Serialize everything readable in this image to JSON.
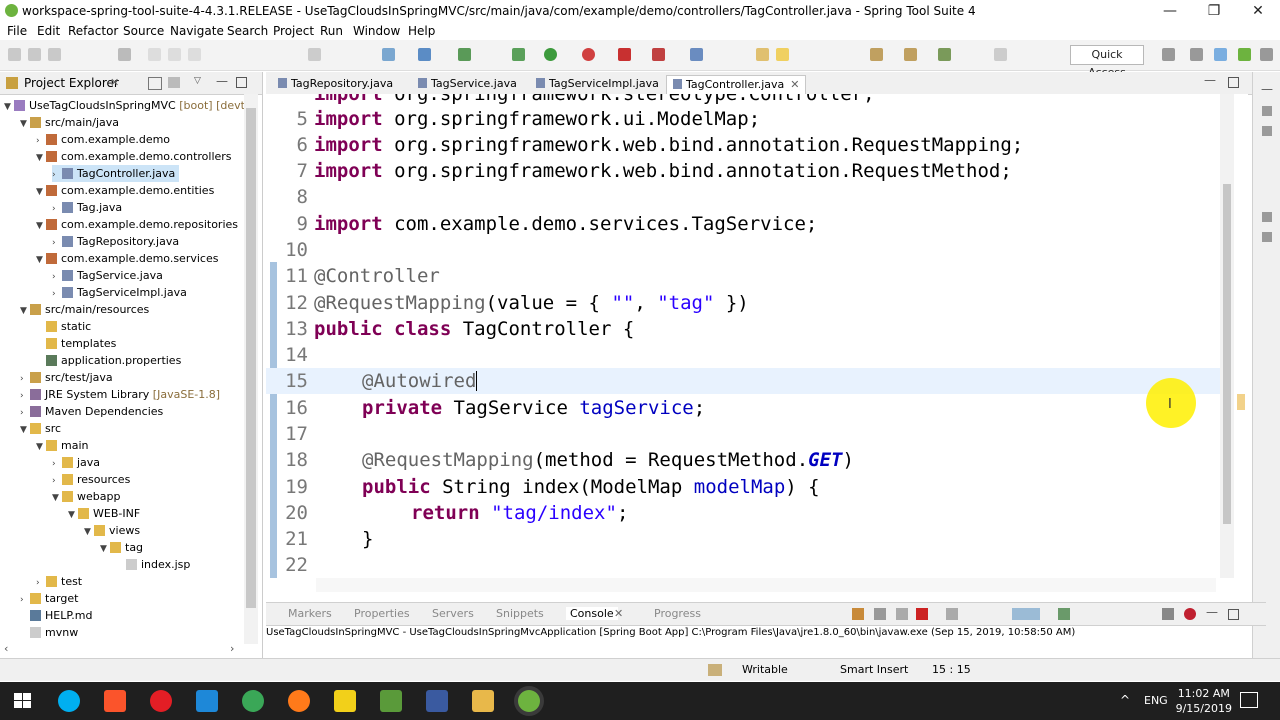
{
  "window": {
    "title": "workspace-spring-tool-suite-4-4.3.1.RELEASE - UseTagCloudsInSpringMVC/src/main/java/com/example/demo/controllers/TagController.java - Spring Tool Suite 4",
    "minimize": "—",
    "maximize": "❐",
    "close": "✕"
  },
  "menu": [
    "File",
    "Edit",
    "Refactor",
    "Source",
    "Navigate",
    "Search",
    "Project",
    "Run",
    "Window",
    "Help"
  ],
  "toolbar": {
    "quick_access": "Quick Access"
  },
  "project_explorer": {
    "title": "Project Explorer",
    "items": [
      {
        "label": "UseTagCloudsInSpringMVC",
        "suffix": " [boot] [devtools]"
      },
      {
        "label": "src/main/java"
      },
      {
        "label": "com.example.demo"
      },
      {
        "label": "com.example.demo.controllers"
      },
      {
        "label": "TagController.java"
      },
      {
        "label": "com.example.demo.entities"
      },
      {
        "label": "Tag.java"
      },
      {
        "label": "com.example.demo.repositories"
      },
      {
        "label": "TagRepository.java"
      },
      {
        "label": "com.example.demo.services"
      },
      {
        "label": "TagService.java"
      },
      {
        "label": "TagServiceImpl.java"
      },
      {
        "label": "src/main/resources"
      },
      {
        "label": "static"
      },
      {
        "label": "templates"
      },
      {
        "label": "application.properties"
      },
      {
        "label": "src/test/java"
      },
      {
        "label": "JRE System Library",
        "suffix": " [JavaSE-1.8]"
      },
      {
        "label": "Maven Dependencies"
      },
      {
        "label": "src"
      },
      {
        "label": "main"
      },
      {
        "label": "java"
      },
      {
        "label": "resources"
      },
      {
        "label": "webapp"
      },
      {
        "label": "WEB-INF"
      },
      {
        "label": "views"
      },
      {
        "label": "tag"
      },
      {
        "label": "index.jsp"
      },
      {
        "label": "test"
      },
      {
        "label": "target"
      },
      {
        "label": "HELP.md"
      },
      {
        "label": "mvnw"
      }
    ]
  },
  "editor": {
    "tabs": [
      "TagRepository.java",
      "TagService.java",
      "TagServiceImpl.java",
      "TagController.java"
    ],
    "active_tab": "TagController.java",
    "lines": [
      {
        "n": "",
        "kw": "import",
        "rest": " org.springframework.stereotype.Controller;"
      },
      {
        "n": "5",
        "kw": "import",
        "rest": " org.springframework.ui.ModelMap;"
      },
      {
        "n": "6",
        "kw": "import",
        "rest": " org.springframework.web.bind.annotation.RequestMapping;"
      },
      {
        "n": "7",
        "kw": "import",
        "rest": " org.springframework.web.bind.annotation.RequestMethod;"
      },
      {
        "n": "8"
      },
      {
        "n": "9",
        "kw": "import",
        "rest": " com.example.demo.services.TagService;"
      },
      {
        "n": "10"
      },
      {
        "n": "11",
        "ann": "@Controller"
      },
      {
        "n": "12",
        "ann": "@RequestMapping",
        "rest": "(value = { ",
        "s1": "\"\"",
        "mid": ", ",
        "s2": "\"tag\"",
        "end": " })"
      },
      {
        "n": "13",
        "kw": "public class",
        "rest": " TagController {"
      },
      {
        "n": "14"
      },
      {
        "n": "15",
        "ann": "@Autowired"
      },
      {
        "n": "16",
        "kw": "private",
        "rest": " TagService ",
        "fld": "tagService",
        "end": ";"
      },
      {
        "n": "17"
      },
      {
        "n": "18",
        "ann": "@RequestMapping",
        "rest": "(method = RequestMethod.",
        "it": "GET",
        "end": ")"
      },
      {
        "n": "19",
        "kw": "public",
        "rest": " String index(ModelMap ",
        "fld": "modelMap",
        "end": ") {"
      },
      {
        "n": "20",
        "kw": "return",
        "s1": "\"tag/index\"",
        "end": ";"
      },
      {
        "n": "21",
        "rest": "}"
      },
      {
        "n": "22"
      }
    ]
  },
  "console": {
    "tabs": [
      "Markers",
      "Properties",
      "Servers",
      "Snippets",
      "Console",
      "Progress"
    ],
    "active": "Console",
    "line": "UseTagCloudsInSpringMVC - UseTagCloudsInSpringMvcApplication [Spring Boot App] C:\\Program Files\\Java\\jre1.8.0_60\\bin\\javaw.exe (Sep 15, 2019, 10:58:50 AM)"
  },
  "status": {
    "mode": "Writable",
    "insert": "Smart Insert",
    "position": "15 : 15"
  },
  "taskbar": {
    "lang": "ENG",
    "time": "11:02 AM",
    "date": "9/15/2019"
  }
}
